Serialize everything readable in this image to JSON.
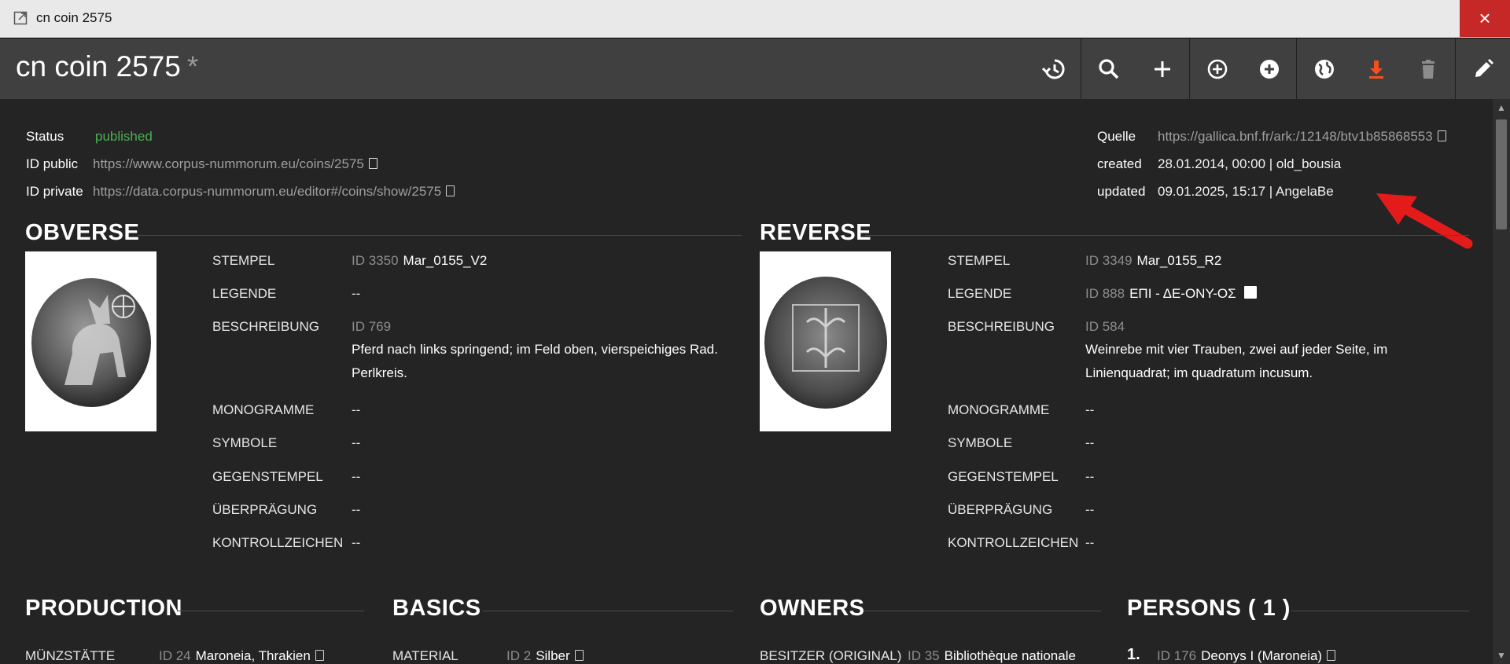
{
  "window": {
    "title": "cn coin 2575",
    "close_label": "×"
  },
  "toolbar": {
    "title": "cn coin 2575",
    "modified_marker": "*",
    "buttons": [
      "history-icon",
      "search-icon",
      "plus-icon",
      "add-circle-outline-icon",
      "add-circle-icon",
      "globe-icon",
      "download-icon",
      "trash-icon",
      "edit-icon"
    ]
  },
  "meta_left": {
    "status_label": "Status",
    "status_value": "published",
    "public_label": "ID public",
    "public_value": "https://www.corpus-nummorum.eu/coins/2575",
    "private_label": "ID private",
    "private_value": "https://data.corpus-nummorum.eu/editor#/coins/show/2575"
  },
  "meta_right": {
    "quelle_label": "Quelle",
    "quelle_value": "https://gallica.bnf.fr/ark:/12148/btv1b85868553",
    "created_label": "created",
    "created_value": "28.01.2014, 00:00  |  old_bousia",
    "updated_label": "updated",
    "updated_value": "09.01.2025, 15:17  |  AngelaBe"
  },
  "obverse": {
    "heading": "OBVERSE",
    "labels": [
      "STEMPEL",
      "LEGENDE",
      "BESCHREIBUNG",
      "MONOGRAMME",
      "SYMBOLE",
      "GEGENSTEMPEL",
      "ÜBERPRÄGUNG",
      "KONTROLLZEICHEN"
    ],
    "stempel_id": "ID 3350",
    "stempel_name": "Mar_0155_V2",
    "legende": "--",
    "beschreibung_id": "ID 769",
    "beschreibung_text": "Pferd nach links springend; im Feld oben, vierspeichiges Rad. Perlkreis.",
    "monogramme": "--",
    "symbole": "--",
    "gegenstempel": "--",
    "ueberpraegung": "--",
    "kontrollzeichen": "--"
  },
  "reverse": {
    "heading": "REVERSE",
    "labels": [
      "STEMPEL",
      "LEGENDE",
      "BESCHREIBUNG",
      "MONOGRAMME",
      "SYMBOLE",
      "GEGENSTEMPEL",
      "ÜBERPRÄGUNG",
      "KONTROLLZEICHEN"
    ],
    "stempel_id": "ID 3349",
    "stempel_name": "Mar_0155_R2",
    "legende_id": "ID 888",
    "legende_text": "ΕΠΙ - ΔΕ-ΟΝΥ-ΟΣ",
    "beschreibung_id": "ID 584",
    "beschreibung_text": "Weinrebe mit vier Trauben, zwei auf jeder Seite, im Linienquadrat; im quadratum incusum.",
    "monogramme": "--",
    "symbole": "--",
    "gegenstempel": "--",
    "ueberpraegung": "--",
    "kontrollzeichen": "--"
  },
  "production": {
    "heading": "PRODUCTION",
    "label": "MÜNZSTÄTTE",
    "id": "ID 24",
    "value": "Maroneia, Thrakien"
  },
  "basics": {
    "heading": "BASICS",
    "label": "MATERIAL",
    "id": "ID 2",
    "value": "Silber"
  },
  "owners": {
    "heading": "OWNERS",
    "label": "BESITZER (ORIGINAL)",
    "id": "ID 35",
    "value": "Bibliothèque nationale"
  },
  "persons": {
    "heading": "PERSONS  ( 1 )",
    "num": "1.",
    "id": "ID 176",
    "value": "Deonys I (Maroneia)"
  }
}
